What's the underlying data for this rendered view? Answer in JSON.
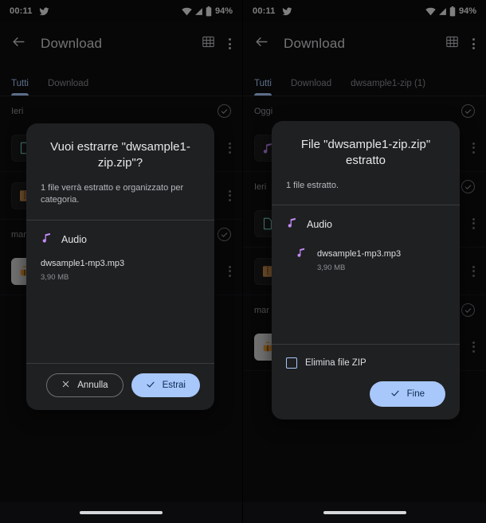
{
  "status_bar": {
    "time": "00:11",
    "battery_percent": "94%",
    "icons": [
      "twitter-bird-icon",
      "wifi-icon",
      "signal-icon",
      "battery-icon"
    ]
  },
  "app_bar": {
    "title": "Download",
    "back_icon": "back-arrow-icon",
    "grid_icon": "grid-view-icon",
    "overflow_icon": "overflow-menu-icon"
  },
  "left_panel": {
    "tabs": [
      {
        "label": "Tutti",
        "active": true
      },
      {
        "label": "Download",
        "active": false
      }
    ],
    "file_list": {
      "groups": [
        {
          "date": "Ieri",
          "rows": [
            {
              "icon": "document-file-icon",
              "selected": false
            },
            {
              "icon": "zip-archive-icon",
              "selected": false
            }
          ]
        },
        {
          "date": "mar",
          "rows": [
            {
              "icon": "apk-android-icon",
              "selected": false
            }
          ]
        }
      ]
    },
    "dialog": {
      "title": "Vuoi estrarre \"dwsample1-zip.zip\"?",
      "subtitle": "1 file verrà estratto e organizzato per categoria.",
      "category": {
        "icon": "music-note-icon",
        "name": "Audio"
      },
      "file": {
        "name": "dwsample1-mp3.mp3",
        "size": "3,90 MB"
      },
      "buttons": {
        "cancel": {
          "label": "Annulla",
          "icon": "close-x-icon"
        },
        "confirm": {
          "label": "Estrai",
          "icon": "checkmark-icon"
        }
      }
    }
  },
  "right_panel": {
    "tabs": [
      {
        "label": "Tutti",
        "active": true
      },
      {
        "label": "Download",
        "active": false
      },
      {
        "label": "dwsample1-zip (1)",
        "active": false
      }
    ],
    "file_list": {
      "groups": [
        {
          "date": "Oggi",
          "rows": [
            {
              "icon": "music-note-icon",
              "selected": false
            }
          ]
        },
        {
          "date": "Ieri",
          "rows": [
            {
              "icon": "document-file-icon",
              "selected": false
            },
            {
              "icon": "zip-archive-icon",
              "selected": false
            }
          ]
        },
        {
          "date": "mar",
          "rows": [
            {
              "icon": "apk-android-icon",
              "selected": false
            }
          ]
        }
      ]
    },
    "dialog": {
      "title": "File \"dwsample1-zip.zip\" estratto",
      "subtitle": "1 file estratto.",
      "category": {
        "icon": "music-note-icon",
        "name": "Audio"
      },
      "file": {
        "name": "dwsample1-mp3.mp3",
        "size": "3,90 MB"
      },
      "checkbox": {
        "label": "Elimina file ZIP",
        "checked": false
      },
      "buttons": {
        "confirm": {
          "label": "Fine",
          "icon": "checkmark-icon"
        }
      }
    }
  },
  "nav_bar": {
    "handle": "home-indicator"
  },
  "colors": {
    "accent": "#a8c7fa",
    "dialog_bg": "#1f2022",
    "screen_bg": "#0e0e10",
    "music_purple": "#c58af9"
  }
}
